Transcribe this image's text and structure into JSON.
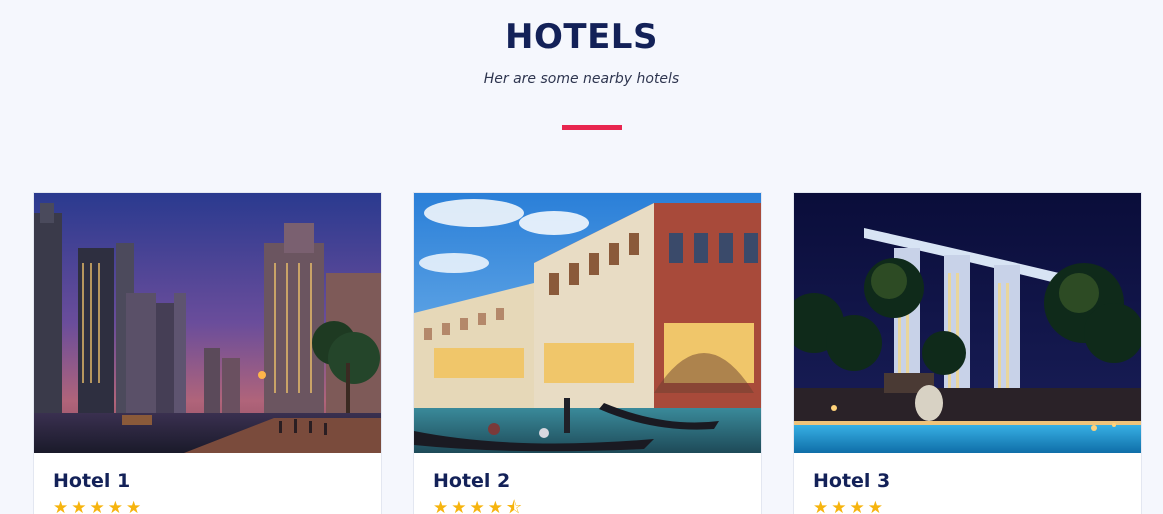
{
  "section": {
    "title": "HOTELS",
    "subtitle": "Her are some nearby hotels",
    "accent_color": "#e8264f",
    "title_color": "#132158"
  },
  "hotels": [
    {
      "name": "Hotel 1",
      "rating": 5,
      "image": "dubai-marina-dusk-photo",
      "stars": [
        "★",
        "★",
        "★",
        "★",
        "★"
      ]
    },
    {
      "name": "Hotel 2",
      "rating": 4.5,
      "image": "venetian-canal-gondola-photo",
      "stars": [
        "★",
        "★",
        "★",
        "★",
        "⯪"
      ]
    },
    {
      "name": "Hotel 3",
      "rating": 4,
      "image": "marina-bay-sands-night-pool-photo",
      "stars": [
        "★",
        "★",
        "★",
        "★"
      ]
    }
  ],
  "star_color": "#f6b40e"
}
